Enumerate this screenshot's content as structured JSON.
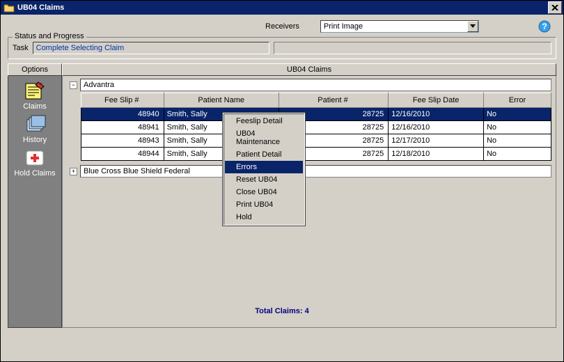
{
  "window": {
    "title": "UB04 Claims"
  },
  "help": "help",
  "receivers": {
    "label": "Receivers",
    "selected": "Print Image"
  },
  "status_group": {
    "legend": "Status and Progress",
    "task_label": "Task",
    "task_value": "Complete Selecting Claim"
  },
  "options": {
    "header": "Options",
    "items": [
      {
        "label": "Claims",
        "icon": "claims-icon"
      },
      {
        "label": "History",
        "icon": "history-icon"
      },
      {
        "label": "Hold Claims",
        "icon": "hold-claims-icon"
      }
    ]
  },
  "main": {
    "header": "UB04 Claims",
    "groups": [
      {
        "name": "Advantra",
        "expanded": true
      },
      {
        "name": "Blue Cross Blue Shield Federal",
        "expanded": false
      }
    ],
    "columns": [
      "Fee Slip #",
      "Patient Name",
      "Patient #",
      "Fee Slip Date",
      "Error"
    ],
    "rows": [
      {
        "fee": "48940",
        "name": "Smith, Sally",
        "pat": "28725",
        "date": "12/16/2010",
        "err": "No",
        "selected": true
      },
      {
        "fee": "48941",
        "name": "Smith, Sally",
        "pat": "28725",
        "date": "12/16/2010",
        "err": "No"
      },
      {
        "fee": "48943",
        "name": "Smith, Sally",
        "pat": "28725",
        "date": "12/17/2010",
        "err": "No"
      },
      {
        "fee": "48944",
        "name": "Smith, Sally",
        "pat": "28725",
        "date": "12/18/2010",
        "err": "No"
      }
    ]
  },
  "contextmenu": {
    "items": [
      "Feeslip Detail",
      "UB04 Maintenance",
      "Patient Detail",
      "Errors",
      "Reset UB04",
      "Close UB04",
      "Print UB04",
      "Hold"
    ],
    "selected_index": 3
  },
  "footer": {
    "total_label": "Total Claims:",
    "total_value": "4"
  }
}
